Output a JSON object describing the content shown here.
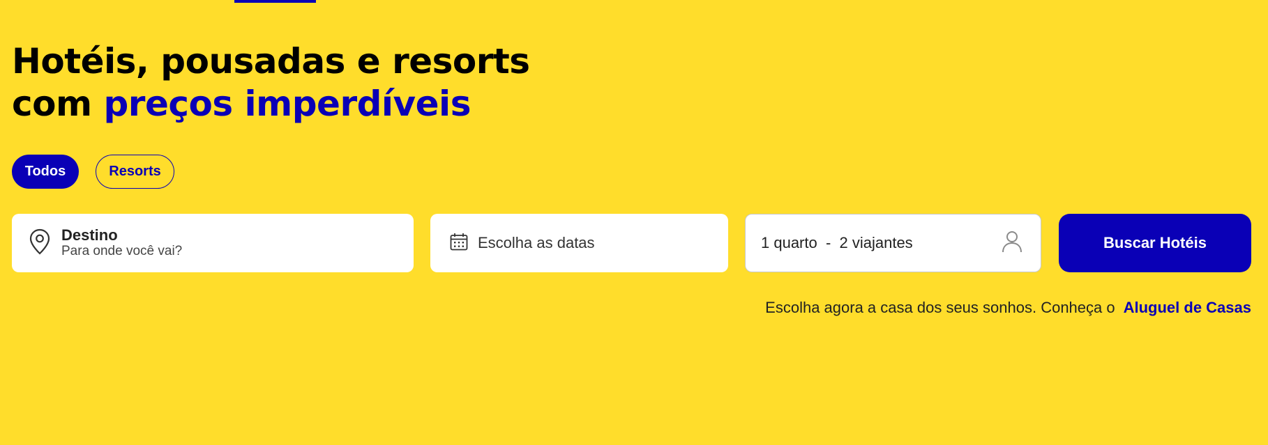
{
  "headline": {
    "line1": "Hotéis, pousadas e resorts",
    "line2_prefix": "com ",
    "line2_accent": "preços imperdíveis"
  },
  "filters": {
    "all_label": "Todos",
    "resorts_label": "Resorts",
    "selected": "Todos"
  },
  "search": {
    "destination_label": "Destino",
    "destination_placeholder": "Para onde você vai?",
    "dates_placeholder": "Escolha as datas",
    "guests_value": "1 quarto  -  2 viajantes",
    "submit_label": "Buscar Hotéis"
  },
  "promo": {
    "text": "Escolha agora a casa dos seus sonhos. Conheça o",
    "link_label": "Aluguel de Casas"
  },
  "icons": {
    "destination": "map-pin-icon",
    "dates": "calendar-icon",
    "guests": "user-icon"
  },
  "colors": {
    "background": "#FFDD2B",
    "accent": "#0A00B6"
  }
}
